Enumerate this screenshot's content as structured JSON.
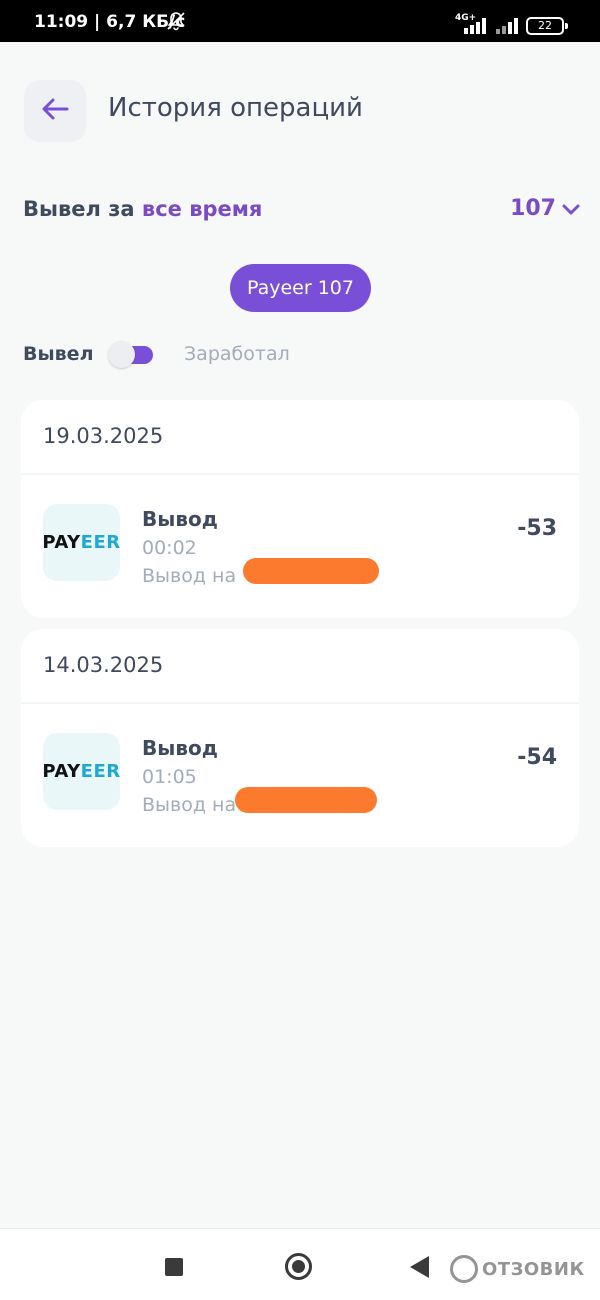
{
  "status_bar": {
    "time": "11:09 | 6,7 КБ/с",
    "network": "4G+",
    "battery": "22",
    "mute_icon": "bell-off-icon"
  },
  "header": {
    "back_icon": "arrow-left-icon",
    "title": "История операций"
  },
  "summary": {
    "prefix": "Вывел за",
    "period": "все время",
    "total": "107",
    "dropdown_icon": "chevron-down-icon"
  },
  "filter_chip": {
    "label": "Payeer 107"
  },
  "toggle": {
    "left_label": "Вывел",
    "right_label": "Заработал",
    "state": "Вывел"
  },
  "operations": [
    {
      "date": "19.03.2025",
      "logo_pay": "PAY",
      "logo_eer": "EER",
      "title": "Вывод",
      "time": "00:02",
      "description": "Вывод на",
      "amount": "-53"
    },
    {
      "date": "14.03.2025",
      "logo_pay": "PAY",
      "logo_eer": "EER",
      "title": "Вывод",
      "time": "01:05",
      "description": "Вывод на",
      "amount": "-54"
    }
  ],
  "colors": {
    "accent": "#7a4fd8",
    "accent_text": "#7a4bc4",
    "text": "#3f4a5e",
    "muted": "#a3acb9",
    "payeer_blue": "#1fa8d1",
    "redaction": "#fb7a2e"
  },
  "watermark": {
    "text": "ОТЗОВИК"
  }
}
